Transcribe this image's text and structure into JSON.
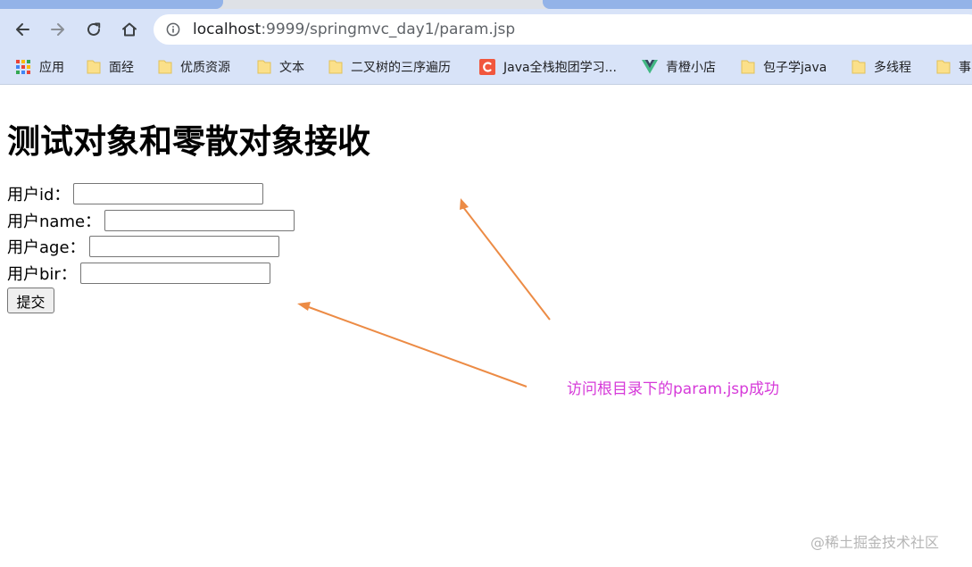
{
  "browser": {
    "address_host": "localhost",
    "address_path": ":9999/springmvc_day1/param.jsp"
  },
  "bookmarks": [
    {
      "label": "应用",
      "icon": "apps-grid-icon"
    },
    {
      "label": "面经",
      "icon": "folder-icon"
    },
    {
      "label": "优质资源",
      "icon": "folder-icon"
    },
    {
      "label": "文本",
      "icon": "folder-icon"
    },
    {
      "label": "二叉树的三序遍历",
      "icon": "folder-icon"
    },
    {
      "label": "Java全栈抱团学习...",
      "icon": "csdn-c-icon"
    },
    {
      "label": "青橙小店",
      "icon": "vue-logo-icon"
    },
    {
      "label": "包子学java",
      "icon": "folder-icon"
    },
    {
      "label": "多线程",
      "icon": "folder-icon"
    },
    {
      "label": "事",
      "icon": "folder-icon"
    }
  ],
  "page": {
    "title": "测试对象和零散对象接收",
    "fields": [
      {
        "label": "用户id：",
        "value": ""
      },
      {
        "label": "用户name：",
        "value": ""
      },
      {
        "label": "用户age：",
        "value": ""
      },
      {
        "label": "用户bir：",
        "value": ""
      }
    ],
    "submit_label": "提交"
  },
  "annotation": {
    "text": "访问根目录下的param.jsp成功",
    "color": "#d63ad9",
    "arrow_color": "#ec8b45"
  },
  "watermark": "@稀土掘金技术社区"
}
